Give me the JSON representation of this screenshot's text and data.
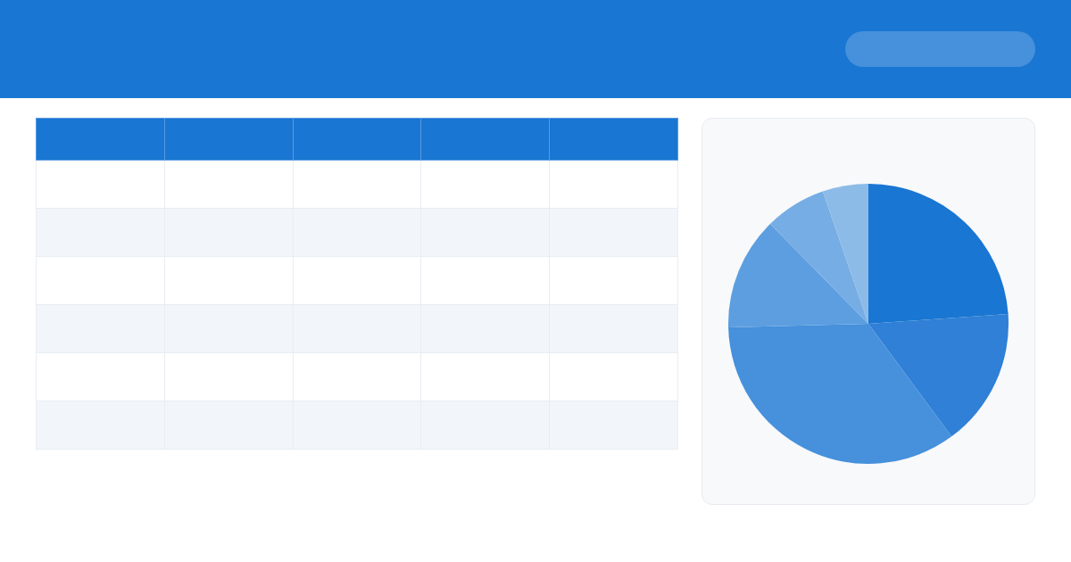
{
  "pie": {
    "slices": [
      {
        "color": "#1976d2"
      },
      {
        "color": "#2f80d6"
      },
      {
        "color": "#4690dc"
      },
      {
        "color": "#5c9ee0"
      },
      {
        "color": "#76ade4"
      },
      {
        "color": "#8cbbe8"
      }
    ]
  }
}
